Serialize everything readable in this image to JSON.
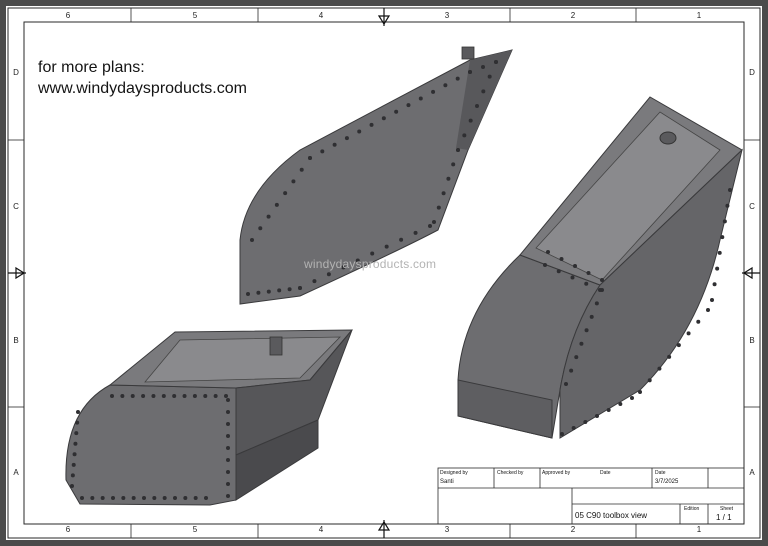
{
  "note": {
    "line1": "for more plans:",
    "line2": "www.windydaysproducts.com"
  },
  "watermark": "windydaysproducts.com",
  "zones": {
    "columns": [
      "6",
      "5",
      "4",
      "3",
      "2",
      "1"
    ],
    "rows": [
      "D",
      "C",
      "B",
      "A"
    ]
  },
  "title_block": {
    "designed_by_label": "Designed by",
    "designed_by": "Santi",
    "checked_by_label": "Checked by",
    "approved_by_label": "Approved by",
    "date_label_1": "Date",
    "date_label_2": "Date",
    "date": "3/7/2025",
    "drawing_title": "05 C90 toolbox view",
    "edition_label": "Edition",
    "sheet_label": "Sheet",
    "sheet": "1 / 1"
  },
  "colors": {
    "frame": "#2a2a2a",
    "part_body": "#6d6d70",
    "part_shadow": "#4a4a4d",
    "part_light": "#8a8a8d",
    "rivet": "#2f2f32"
  }
}
